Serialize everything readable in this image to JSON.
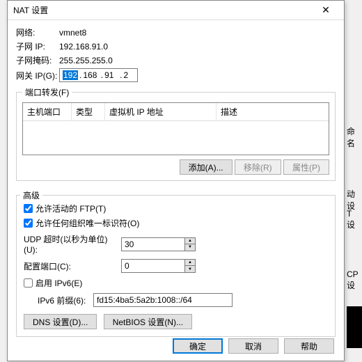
{
  "dialog": {
    "title": "NAT 设置",
    "close": "✕"
  },
  "network": {
    "label": "网络:",
    "value": "vmnet8"
  },
  "subnet_ip": {
    "label": "子网 IP:",
    "value": "192.168.91.0"
  },
  "subnet_mask": {
    "label": "子网掩码:",
    "value": "255.255.255.0"
  },
  "gateway": {
    "label": "网关 IP(G):",
    "oct1": "192",
    "oct2": "168",
    "oct3": "91",
    "oct4": "2"
  },
  "port_forward": {
    "legend": "端口转发(F)",
    "cols": {
      "host_port": "主机端口",
      "type": "类型",
      "vm_ip": "虚拟机 IP 地址",
      "desc": "描述"
    },
    "add_btn": "添加(A)...",
    "remove_btn": "移除(R)",
    "props_btn": "属性(P)"
  },
  "advanced": {
    "title": "高级",
    "allow_ftp": "允许活动的 FTP(T)",
    "allow_oui": "允许任何组织唯一标识符(O)",
    "udp_label": "UDP 超时(以秒为单位)(U):",
    "udp_value": "30",
    "cfg_port_label": "配置端口(C):",
    "cfg_port_value": "0",
    "enable_ipv6": "启用 IPv6(E)",
    "ipv6_prefix_label": "IPv6 前缀(6):",
    "ipv6_prefix_value": "fd15:4ba5:5a2b:1008::/64",
    "dns_btn": "DNS 设置(D)...",
    "netbios_btn": "NetBIOS 设置(N)..."
  },
  "footer": {
    "ok": "确定",
    "cancel": "取消",
    "help": "帮助"
  },
  "bg": {
    "r1": "命名",
    "r2": "动设",
    "r3": "T 设",
    "r4": "CP 设"
  }
}
